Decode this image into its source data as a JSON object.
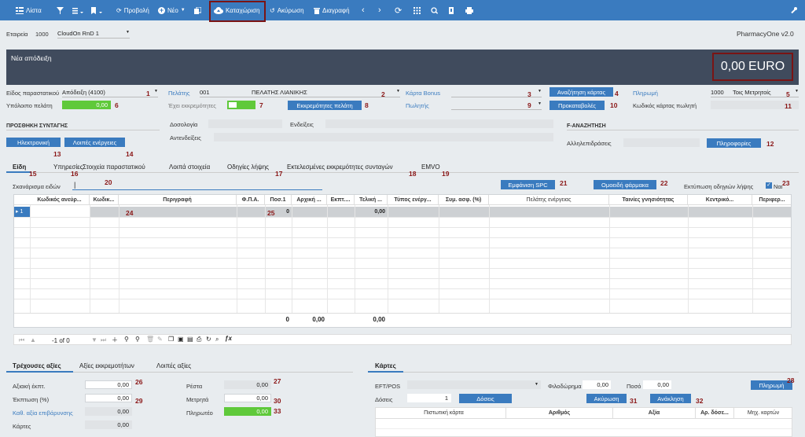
{
  "toolbar": {
    "list": "Λίστα",
    "view": "Προβολή",
    "new": "Νέο",
    "register": "Καταχώριση",
    "cancel": "Ακύρωση",
    "delete": "Διαγραφή"
  },
  "company": {
    "label": "Εταιρεία",
    "code": "1000",
    "name": "CloudOn RnD 1",
    "app": "PharmacyOne v2.0"
  },
  "header": {
    "title": "Νέα απόδειξη",
    "amount": "0,00",
    "currency": "EURO"
  },
  "form": {
    "doc_type_label": "Είδος παραστατικού",
    "doc_type_value": "Απόδειξη (4100)",
    "balance_label": "Υπόλοιπο πελάτη",
    "balance_value": "0,00",
    "customer_label": "Πελάτης",
    "customer_code": "001",
    "customer_name": "ΠΕΛΑΤΗΣ ΛΙΑΝΙΚΗΣ",
    "pending_label": "Έχει εκκρεμότητες",
    "pending_btn": "Εκκρεμότητες πελάτη",
    "bonus_label": "Κάρτα Bonus",
    "seller_label": "Πωλητής",
    "search_card_btn": "Αναζήτηση κάρτας",
    "prepaid_btn": "Προκαταβολές",
    "payment_label": "Πληρωμή",
    "payment_code": "1000",
    "payment_value": "Τοις Μετρητοίς",
    "seller_card_label": "Κωδικός κάρτας πωλητή",
    "rx_title": "ΠΡΟΣΘΗΚΗ ΣΥΝΤΑΓΗΣ",
    "electronic_btn": "Ηλεκτρονική",
    "other_btn": "Λοιπές ενέργειες",
    "dosage_label": "Δοσολογία",
    "indications_label": "Ενδείξεις",
    "contra_label": "Αντενδείξεις",
    "f_search_title": "F-ΑΝΑΖΗΤΗΣΗ",
    "interactions_label": "Αλληλεπιδράσεις",
    "info_btn": "Πληροφορίες"
  },
  "tabs": [
    "Είδη",
    "Υπηρεσίες",
    "Στοιχεία παραστατικού",
    "Λοιπά στοιχεία",
    "Οδηγίες λήψης",
    "Εκτελεσμένες εκκρεμότητες συνταγών",
    "EMVO"
  ],
  "scan": {
    "label": "Σκανάρισμα ειδών",
    "spc_btn": "Εμφάνιση SPC",
    "homo_btn": "Ομοειδή φάρμακα",
    "print_label": "Εκτύπωση οδηγιών λήψης",
    "yes_label": "Ναι"
  },
  "grid": {
    "headers": [
      "Κωδικός ανεύρ...",
      "Κωδικ...",
      "Περιγραφή",
      "Φ.Π.Α.",
      "Ποσ.1",
      "Αρχική ...",
      "Εκπτ....",
      "Τελική ...",
      "Τύπος ενέργ...",
      "Συμ. ασφ. (%)",
      "Πελάτης ενέργειας",
      "Ταινίες γνησιότητας",
      "Κεντρικό...",
      "Περιφερ..."
    ],
    "row_num": "1",
    "qty": "0",
    "final": "0,00",
    "totals": [
      "0",
      "0,00",
      "0,00"
    ],
    "pager": "-1 of 0"
  },
  "bottom_tabs": [
    "Τρέχουσες αξίες",
    "Αξίες εκκρεμοτήτων",
    "Λοιπές αξίες"
  ],
  "values": {
    "disc_label": "Αξιακή έκπτ.",
    "disc_val": "0,00",
    "pct_label": "Έκπτωση (%)",
    "pct_val": "0,00",
    "net_label": "Καθ. αξία επιβάρυνσης",
    "net_val": "0,00",
    "cards_label": "Κάρτες",
    "cards_val": "0,00",
    "change_label": "Ρέστα",
    "change_val": "0,00",
    "cash_label": "Μετρητά",
    "cash_val": "0,00",
    "payable_label": "Πληρωτέο",
    "payable_val": "0,00"
  },
  "cards": {
    "tab": "Κάρτες",
    "eft_label": "EFT/POS",
    "tip_label": "Φιλοδώρημα",
    "tip_val": "0,00",
    "amount_label": "Ποσό",
    "amount_val": "0,00",
    "pay_btn": "Πληρωμή",
    "inst_label": "Δόσεις",
    "inst_val": "1",
    "inst_btn": "Δόσεις",
    "cancel_btn": "Ακύρωση",
    "recall_btn": "Ανάκληση",
    "headers": [
      "Πιστωτική κάρτα",
      "Αριθμός",
      "Αξία",
      "Αρ. δόσε...",
      "Μηχ. καρτών"
    ]
  },
  "markers": [
    "1",
    "2",
    "3",
    "4",
    "5",
    "6",
    "7",
    "8",
    "9",
    "10",
    "11",
    "12",
    "13",
    "14",
    "15",
    "16",
    "17",
    "18",
    "19",
    "20",
    "21",
    "22",
    "23",
    "24",
    "25",
    "26",
    "27",
    "28",
    "29",
    "30",
    "31",
    "32",
    "33"
  ],
  "colors": {
    "toolbar": "#3a7bbf",
    "header_band": "#404b5d",
    "green": "#5fc93a",
    "marker": "#8a1616"
  }
}
